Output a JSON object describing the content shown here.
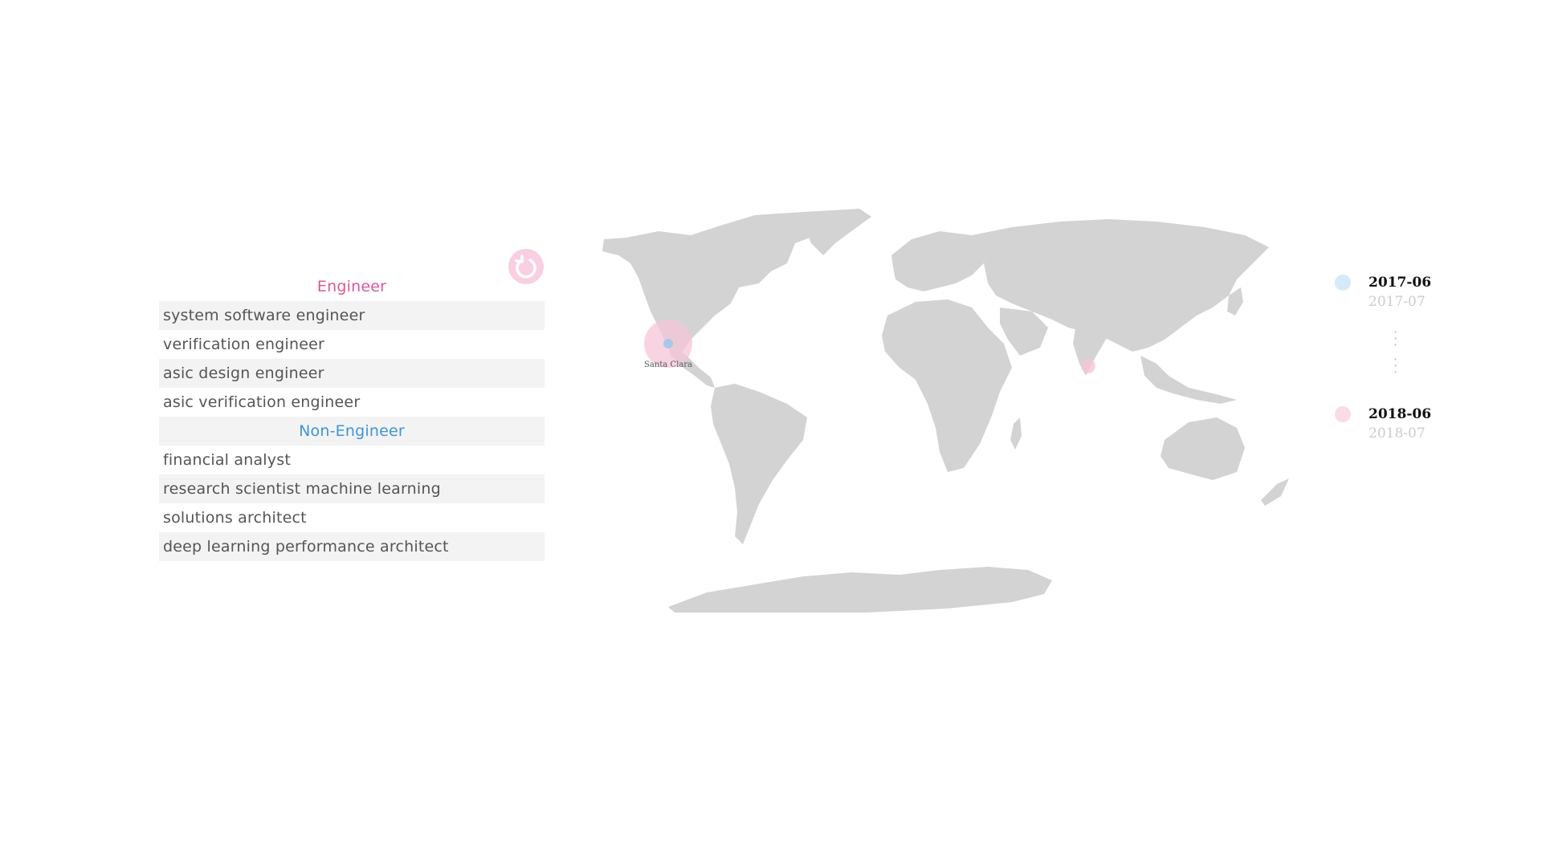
{
  "job_list": {
    "engineer_header": "Engineer",
    "engineer_items": [
      "system software engineer",
      "verification engineer",
      "asic design engineer",
      "asic verification engineer"
    ],
    "nonengineer_header": "Non-Engineer",
    "nonengineer_items": [
      "financial analyst",
      "research scientist machine learning",
      "solutions architect",
      "deep learning performance architect"
    ]
  },
  "reset": {
    "icon": "refresh-icon"
  },
  "map": {
    "land_color": "#d3d3d3",
    "markers": [
      {
        "label": "Santa Clara",
        "color": "#f5c6da"
      },
      {
        "label": "",
        "color": "#f5c6da"
      }
    ]
  },
  "timeline": {
    "entries": [
      {
        "date": "2017-06",
        "next": "2017-07",
        "color": "#d6ebfa"
      },
      {
        "date": "2018-06",
        "next": "2018-07",
        "color": "#fbdbe8"
      }
    ]
  },
  "colors": {
    "engineer": "#e0559a",
    "non_engineer": "#3f94db",
    "row_shade": "#f3f3f3"
  }
}
